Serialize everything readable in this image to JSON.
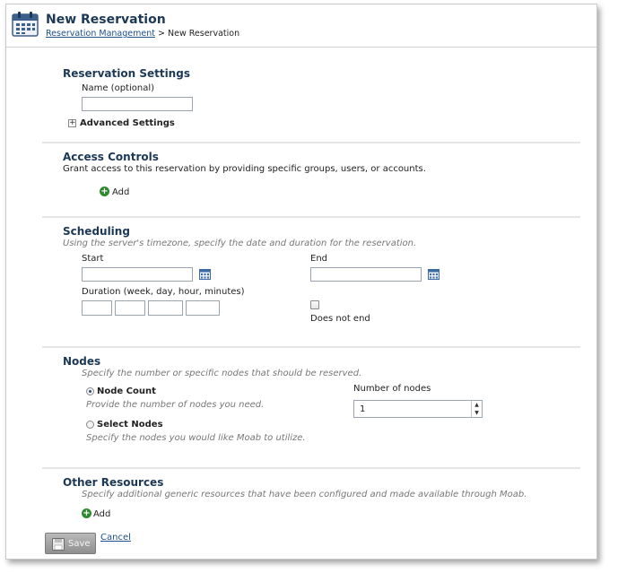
{
  "header": {
    "title": "New Reservation",
    "breadcrumb_link": "Reservation Management",
    "breadcrumb_sep": ">",
    "breadcrumb_current": "New Reservation"
  },
  "reservation_settings": {
    "title": "Reservation Settings",
    "name_label": "Name (optional)",
    "name_value": "",
    "advanced_label": "Advanced Settings",
    "expander_glyph": "+"
  },
  "access_controls": {
    "title": "Access Controls",
    "description": "Grant access to this reservation by providing specific groups, users, or accounts.",
    "add_label": "Add"
  },
  "scheduling": {
    "title": "Scheduling",
    "description": "Using the server's timezone, specify the date and duration for the reservation.",
    "start_label": "Start",
    "end_label": "End",
    "duration_label": "Duration (week, day, hour, minutes)",
    "does_not_end_label": "Does not end",
    "does_not_end_checked": false
  },
  "nodes": {
    "title": "Nodes",
    "description": "Specify the number or specific nodes that should be reserved.",
    "node_count_label": "Node Count",
    "node_count_help": "Provide the number of nodes you need.",
    "select_nodes_label": "Select Nodes",
    "select_nodes_help": "Specify the nodes you would like Moab to utilize.",
    "selected": "node-count",
    "number_of_nodes_label": "Number of nodes",
    "number_of_nodes_value": "1"
  },
  "other_resources": {
    "title": "Other Resources",
    "description": "Specify additional generic resources that have been configured and made available through Moab.",
    "add_label": "Add"
  },
  "actions": {
    "save_label": "Save",
    "cancel_label": "Cancel"
  },
  "colors": {
    "heading": "#1c3857",
    "link": "#1e4f8a",
    "add_icon": "#2f8a2f",
    "save_button": "#a3a3a3"
  },
  "icons": {
    "header": "calendar-icon",
    "date_picker": "calendar-icon",
    "add": "plus-circle-icon",
    "save": "floppy-disk-icon"
  }
}
